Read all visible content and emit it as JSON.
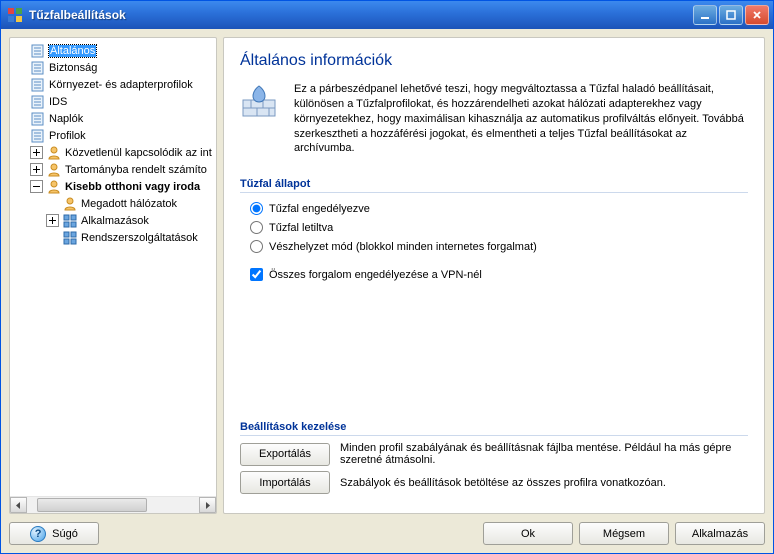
{
  "window": {
    "title": "Tűzfalbeállítások"
  },
  "tree": {
    "items": [
      {
        "label": "Általános",
        "depth": 0,
        "expander": "none",
        "selected": true,
        "bold": false,
        "icon": "page"
      },
      {
        "label": "Biztonság",
        "depth": 0,
        "expander": "none",
        "selected": false,
        "bold": false,
        "icon": "page"
      },
      {
        "label": "Környezet- és adapterprofilok",
        "depth": 0,
        "expander": "none",
        "selected": false,
        "bold": false,
        "icon": "page"
      },
      {
        "label": "IDS",
        "depth": 0,
        "expander": "none",
        "selected": false,
        "bold": false,
        "icon": "page"
      },
      {
        "label": "Naplók",
        "depth": 0,
        "expander": "none",
        "selected": false,
        "bold": false,
        "icon": "page"
      },
      {
        "label": "Profilok",
        "depth": 0,
        "expander": "none",
        "selected": false,
        "bold": false,
        "icon": "page"
      },
      {
        "label": "Közvetlenül kapcsolódik az int",
        "depth": 1,
        "expander": "plus",
        "selected": false,
        "bold": false,
        "icon": "user"
      },
      {
        "label": "Tartományba rendelt számíto",
        "depth": 1,
        "expander": "plus",
        "selected": false,
        "bold": false,
        "icon": "user"
      },
      {
        "label": "Kisebb otthoni vagy iroda",
        "depth": 1,
        "expander": "minus",
        "selected": false,
        "bold": true,
        "icon": "user"
      },
      {
        "label": "Megadott hálózatok",
        "depth": 2,
        "expander": "none",
        "selected": false,
        "bold": false,
        "icon": "user"
      },
      {
        "label": "Alkalmazások",
        "depth": 2,
        "expander": "plus",
        "selected": false,
        "bold": false,
        "icon": "apps"
      },
      {
        "label": "Rendszerszolgáltatások",
        "depth": 2,
        "expander": "none",
        "selected": false,
        "bold": false,
        "icon": "apps"
      }
    ]
  },
  "content": {
    "heading": "Általános információk",
    "intro": "Ez a párbeszédpanel lehetővé teszi, hogy megváltoztassa a Tűzfal haladó beállításait, különösen a Tűzfalprofilokat, és hozzárendelheti azokat hálózati adapterekhez vagy környezetekhez, hogy maximálisan kihasználja az automatikus profilváltás előnyeit. Továbbá szerkesztheti a hozzáférési jogokat, és elmentheti a teljes Tűzfal beállításokat az archívumba.",
    "status_group_title": "Tűzfal állapot",
    "radio_enabled": "Tűzfal engedélyezve",
    "radio_disabled": "Tűzfal letiltva",
    "radio_emergency": "Vészhelyzet mód (blokkol minden internetes forgalmat)",
    "checkbox_vpn": "Összes forgalom engedélyezése a VPN-nél",
    "radio_state": "enabled",
    "checkbox_vpn_checked": true,
    "manage_group_title": "Beállítások kezelése",
    "export_label": "Exportálás",
    "export_desc": "Minden profil szabályának és beállításnak fájlba mentése. Például ha más gépre szeretné átmásolni.",
    "import_label": "Importálás",
    "import_desc": "Szabályok és beállítások betöltése az összes profilra vonatkozóan."
  },
  "footer": {
    "help": "Súgó",
    "ok": "Ok",
    "cancel": "Mégsem",
    "apply": "Alkalmazás"
  }
}
